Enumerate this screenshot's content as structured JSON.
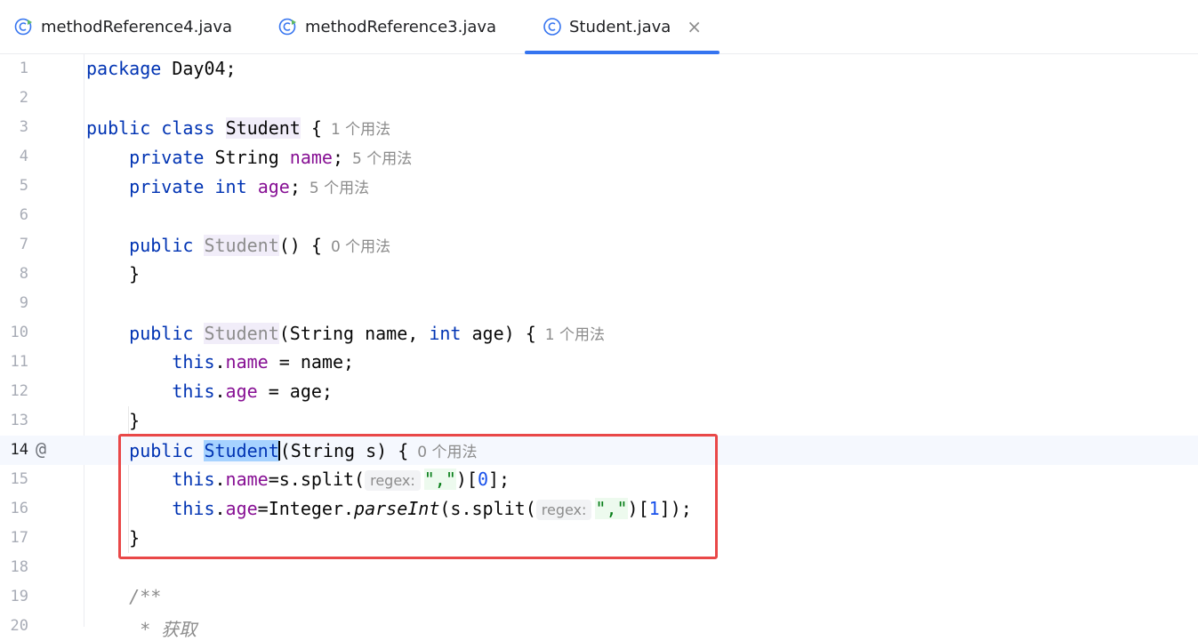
{
  "tabs": [
    {
      "label": "methodReference4.java",
      "active": false
    },
    {
      "label": "methodReference3.java",
      "active": false
    },
    {
      "label": "Student.java",
      "active": true
    }
  ],
  "gutter": {
    "line_numbers": [
      "1",
      "2",
      "3",
      "4",
      "5",
      "6",
      "7",
      "8",
      "9",
      "10",
      "11",
      "12",
      "13",
      "14",
      "15",
      "16",
      "17",
      "18",
      "19",
      "20"
    ],
    "at_marker": "@"
  },
  "code": {
    "l1": {
      "kw": "package",
      "rest": " Day04;"
    },
    "l3": {
      "kw1": "public",
      "kw2": "class",
      "name": "Student",
      "rest": " {",
      "hint": "1 个用法"
    },
    "l4": {
      "kw": "private",
      "type": " String ",
      "field": "name",
      "rest": ";",
      "hint": "5 个用法"
    },
    "l5": {
      "kw1": "private",
      "kw2": "int",
      "field": "age",
      "rest": ";",
      "hint": "5 个用法"
    },
    "l7": {
      "kw": "public",
      "name": "Student",
      "rest": "() {",
      "hint": "0 个用法"
    },
    "l8": {
      "text": "}"
    },
    "l10": {
      "kw": "public",
      "name": "Student",
      "p1": "(String name, ",
      "kw2": "int",
      "p2": " age) {",
      "hint": "1 个用法"
    },
    "l11": {
      "kw": "this",
      "dot": ".",
      "field": "name",
      "rest": " = name;"
    },
    "l12": {
      "kw": "this",
      "dot": ".",
      "field": "age",
      "rest": " = age;"
    },
    "l13": {
      "text": "}"
    },
    "l14": {
      "kw": "public",
      "name": "Student",
      "rest": "(String s) {",
      "hint": "0 个用法"
    },
    "l15": {
      "kw": "this",
      "dot": ".",
      "field": "name",
      "mid": "=s.split(",
      "param": "regex:",
      "str": "\",\"",
      "idx1": ")[",
      "num": "0",
      "end": "];"
    },
    "l16": {
      "kw": "this",
      "dot": ".",
      "field": "age",
      "mid": "=Integer.",
      "method": "parseInt",
      "mid2": "(s.split(",
      "param": "regex:",
      "str": "\",\"",
      "idx1": ")[",
      "num": "1",
      "end": "]);"
    },
    "l17": {
      "text": "}"
    },
    "l19": {
      "text": "/**"
    },
    "l20": {
      "text": " * 获取"
    }
  },
  "colors": {
    "keyword": "#0033b3",
    "field": "#871094",
    "string": "#067d17",
    "number": "#1750eb",
    "accent": "#3574f0",
    "annotation_box": "#e94848"
  }
}
